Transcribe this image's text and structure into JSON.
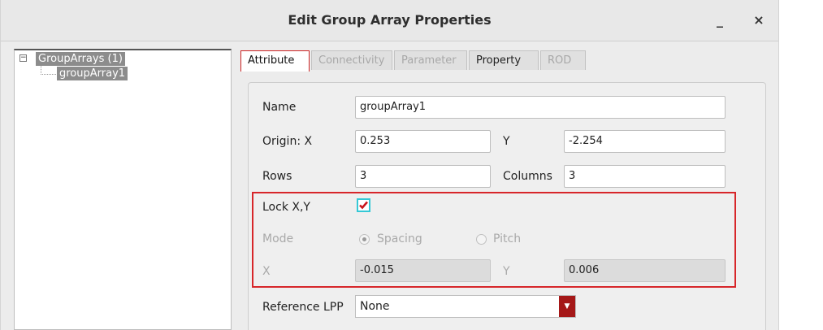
{
  "window": {
    "title": "Edit Group Array Properties",
    "minimize_glyph": "_",
    "close_glyph": "×"
  },
  "tree": {
    "root_expander": "−",
    "root_label": "GroupArrays (1)",
    "child_label": "groupArray1"
  },
  "tabs": [
    {
      "label": "Attribute",
      "state": "active"
    },
    {
      "label": "Connectivity",
      "state": "disabled"
    },
    {
      "label": "Parameter",
      "state": "disabled"
    },
    {
      "label": "Property",
      "state": "enabled"
    },
    {
      "label": "ROD",
      "state": "disabled"
    }
  ],
  "form": {
    "name_label": "Name",
    "name_value": "groupArray1",
    "origin_x_label": "Origin:  X",
    "origin_x_value": "0.253",
    "origin_y_label": "Y",
    "origin_y_value": "-2.254",
    "rows_label": "Rows",
    "rows_value": "3",
    "columns_label": "Columns",
    "columns_value": "3",
    "lock_label": "Lock X,Y",
    "lock_checked": true,
    "mode_label": "Mode",
    "mode_options": [
      {
        "label": "Spacing",
        "selected": true
      },
      {
        "label": "Pitch",
        "selected": false
      }
    ],
    "x_label": "X",
    "x_value": "-0.015",
    "y_label": "Y",
    "y_value": "0.006",
    "ref_lpp_label": "Reference LPP",
    "ref_lpp_value": "None"
  },
  "colors": {
    "highlight_border": "#d7262a",
    "checkbox_focus": "#35c8d6",
    "combo_button": "#a51818"
  }
}
